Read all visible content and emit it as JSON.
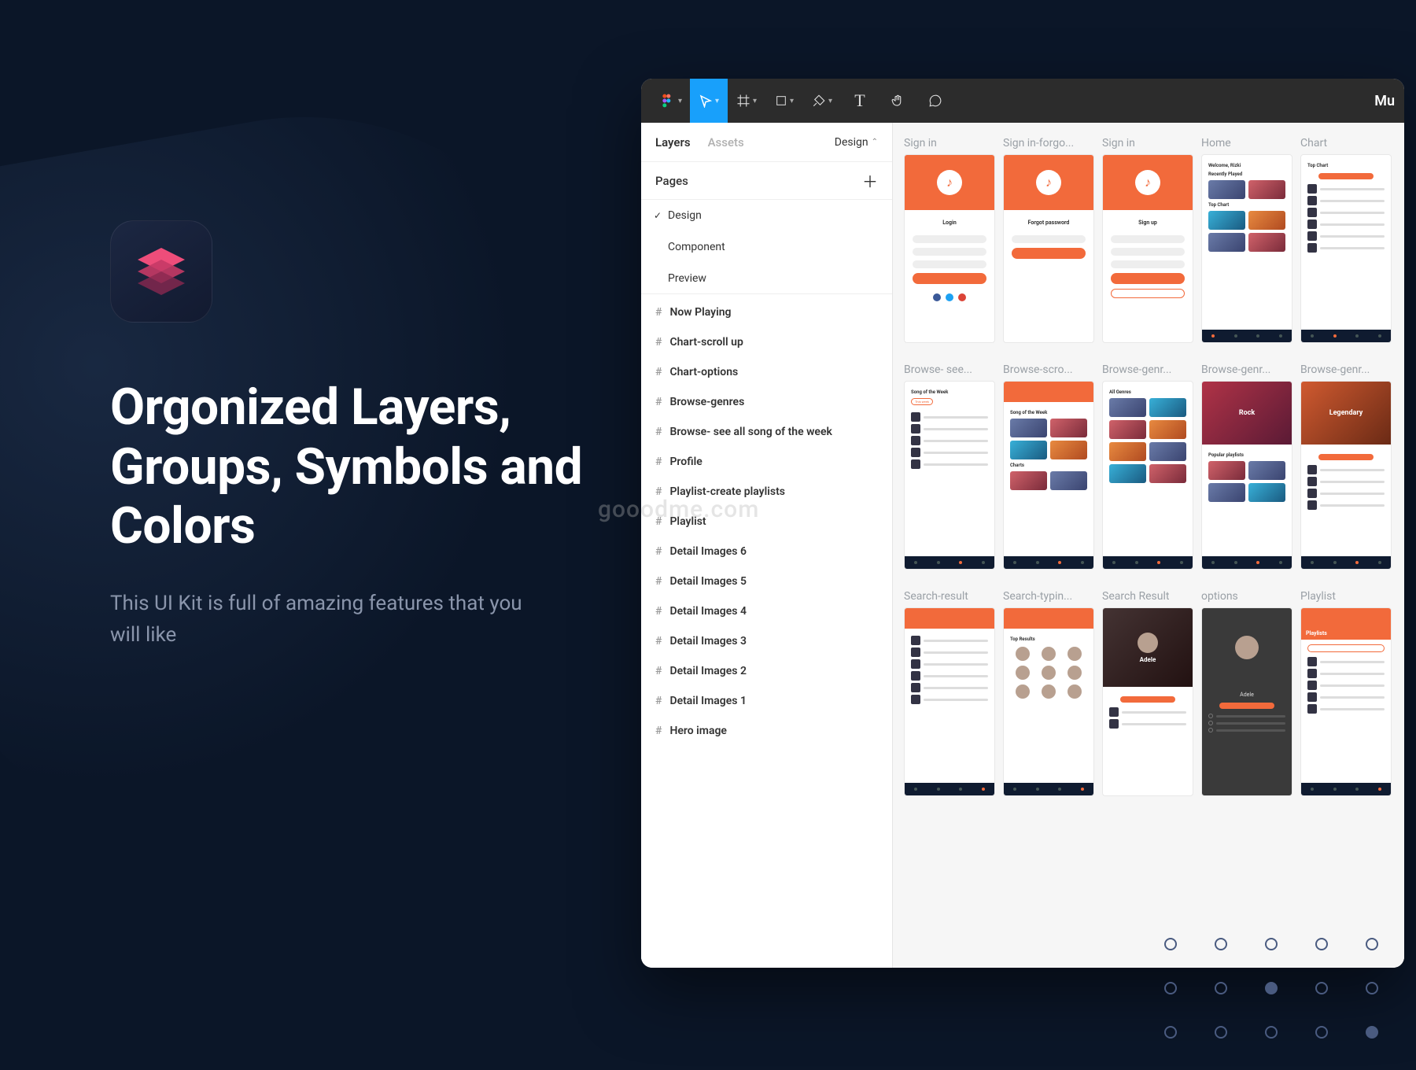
{
  "promo": {
    "headline": "Orgonized Layers, Groups, Symbols and Colors",
    "subtext": "This UI Kit is full of amazing features that you will like"
  },
  "watermark": "gooodme.com",
  "figma": {
    "title": "Mu",
    "toolbar_icons": [
      "figma",
      "pointer",
      "frame",
      "rect",
      "pen",
      "text",
      "hand",
      "comment"
    ],
    "panel": {
      "tabs": {
        "layers": "Layers",
        "assets": "Assets",
        "right": "Design"
      },
      "pages_header": "Pages",
      "pages": [
        "Design",
        "Component",
        "Preview"
      ],
      "pages_selected_index": 0,
      "frames": [
        "Now Playing",
        "Chart-scroll up",
        "Chart-options",
        "Browse-genres",
        "Browse- see all song of the week",
        "Profile",
        "Playlist-create playlists",
        "Playlist",
        "Detail Images 6",
        "Detail Images 5",
        "Detail Images 4",
        "Detail Images 3",
        "Detail Images 2",
        "Detail Images 1",
        "Hero image"
      ]
    },
    "canvas": {
      "row1": [
        "Sign in",
        "Sign in-forgo...",
        "Sign in",
        "Home",
        "Chart"
      ],
      "row2": [
        "Browse- see...",
        "Browse-scro...",
        "Browse-genr...",
        "Browse-genr...",
        "Browse-genr..."
      ],
      "row3": [
        "Search-result",
        "Search-typin...",
        "Search Result",
        "options",
        "Playlist"
      ]
    },
    "artboard_text": {
      "login": "Login",
      "forgot": "Forgot password",
      "signup": "Sign up",
      "welcome": "Welcome, Rizki",
      "recently": "Recently Played",
      "topchart": "Top Chart",
      "song_of_week": "Song of the Week",
      "all_genres": "All Genres",
      "rock": "Rock",
      "legendary": "Legendary",
      "popular": "Popular playlists",
      "adele": "Adele",
      "playlists": "Playlists",
      "charts": "Charts",
      "top_results": "Top Results"
    }
  },
  "colors": {
    "accent": "#f26a3b",
    "navy": "#0f1b30",
    "figma_blue": "#18a0fb",
    "pink": "#ee4d7a"
  }
}
